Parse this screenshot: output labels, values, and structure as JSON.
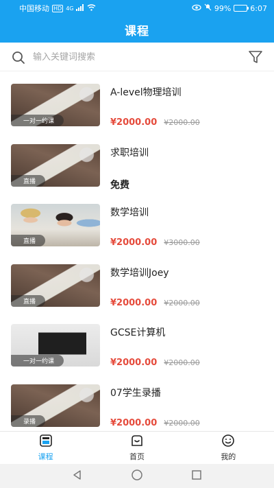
{
  "status_bar": {
    "carrier": "中国移动",
    "hd": "HD",
    "network": "4G",
    "battery": "99%",
    "time": "6:07"
  },
  "header": {
    "title": "课程"
  },
  "search": {
    "placeholder": "输入关键词搜索"
  },
  "courses": [
    {
      "title": "A-level物理培训",
      "price": "¥2000.00",
      "old_price": "¥2000.00",
      "tag": "一对一约课",
      "image": "desk"
    },
    {
      "title": "求职培训",
      "price": "免费",
      "old_price": "",
      "tag": "直播",
      "image": "desk"
    },
    {
      "title": "数学培训",
      "price": "¥2000.00",
      "old_price": "¥3000.00",
      "tag": "直播",
      "image": "people"
    },
    {
      "title": "数学培训Joey",
      "price": "¥2000.00",
      "old_price": "¥2000.00",
      "tag": "直播",
      "image": "desk"
    },
    {
      "title": "GCSE计算机",
      "price": "¥2000.00",
      "old_price": "¥2000.00",
      "tag": "一对一约课",
      "image": "laptop"
    },
    {
      "title": "07学生录播",
      "price": "¥2000.00",
      "old_price": "¥2000.00",
      "tag": "录播",
      "image": "desk"
    }
  ],
  "tabs": [
    {
      "label": "课程",
      "icon": "course-icon",
      "active": true
    },
    {
      "label": "首页",
      "icon": "home-icon",
      "active": false
    },
    {
      "label": "我的",
      "icon": "profile-icon",
      "active": false
    }
  ],
  "colors": {
    "primary": "#1aa2f0",
    "price": "#e54b3c"
  }
}
